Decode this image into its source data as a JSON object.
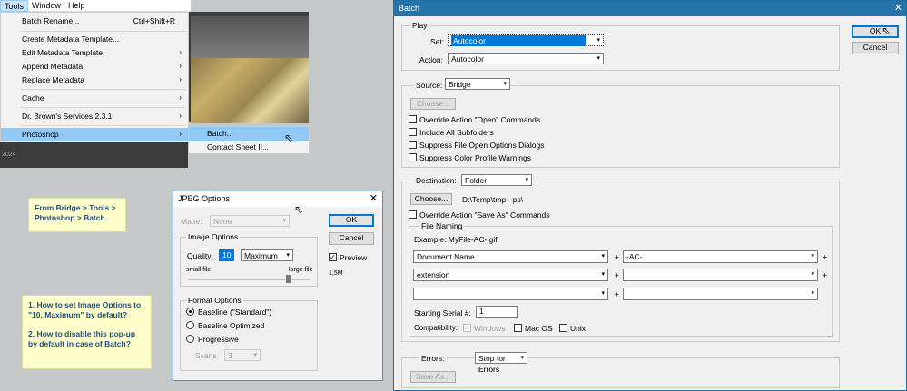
{
  "menubar": {
    "items": [
      "Tools",
      "Window",
      "Help"
    ]
  },
  "tools_menu": {
    "items": [
      {
        "label": "Batch Rename...",
        "shortcut": "Ctrl+Shift+R"
      },
      {
        "label": "Create Metadata Template..."
      },
      {
        "label": "Edit Metadata Template"
      },
      {
        "label": "Append Metadata"
      },
      {
        "label": "Replace Metadata"
      },
      {
        "label": "Cache"
      },
      {
        "label": "Dr. Brown's Services 2.3.1"
      },
      {
        "label": "Photoshop"
      }
    ],
    "submenu": [
      "Batch...",
      "Contact Sheet II..."
    ]
  },
  "year": "2024",
  "notes": {
    "bridge": "From Bridge > Tools > Photoshop > Batch",
    "q1": "1. How to set Image Options to \"10, Maximum\" by default?",
    "q2": "2. How to disable this pop-up by default in case of Batch?"
  },
  "jpeg": {
    "title": "JPEG Options",
    "matte_label": "Matte:",
    "matte_value": "None",
    "image_options": "Image Options",
    "quality_label": "Quality:",
    "quality_value": "10",
    "quality_preset": "Maximum",
    "small_file": "small file",
    "large_file": "large file",
    "format_options": "Format Options",
    "format": [
      "Baseline (\"Standard\")",
      "Baseline Optimized",
      "Progressive"
    ],
    "scans_label": "Scans:",
    "scans_value": "3",
    "ok": "OK",
    "cancel": "Cancel",
    "preview": "Preview",
    "size": "1,5M"
  },
  "batch": {
    "title": "Batch",
    "ok": "OK",
    "cancel": "Cancel",
    "play": "Play",
    "set_label": "Set:",
    "set_value": "Autocolor",
    "action_label": "Action:",
    "action_value": "Autocolor",
    "source_label": "Source:",
    "source_value": "Bridge",
    "choose": "Choose...",
    "source_checks": [
      "Override Action \"Open\" Commands",
      "Include All Subfolders",
      "Suppress File Open Options Dialogs",
      "Suppress Color Profile Warnings"
    ],
    "destination_label": "Destination:",
    "destination_value": "Folder",
    "dest_path": "D:\\Temp\\tmp - ps\\",
    "override_save": "Override Action \"Save As\" Commands",
    "file_naming": "File Naming",
    "example": "Example: MyFile-AC-.gif",
    "naming": [
      [
        "Document Name",
        "-AC-"
      ],
      [
        "extension",
        ""
      ],
      [
        "",
        ""
      ]
    ],
    "plus": "+",
    "serial_label": "Starting Serial #:",
    "serial_value": "1",
    "compat_label": "Compatibility:",
    "compat": [
      "Windows",
      "Mac OS",
      "Unix"
    ],
    "errors_label": "Errors:",
    "errors_value": "Stop for Errors",
    "save_as": "Save As..."
  }
}
